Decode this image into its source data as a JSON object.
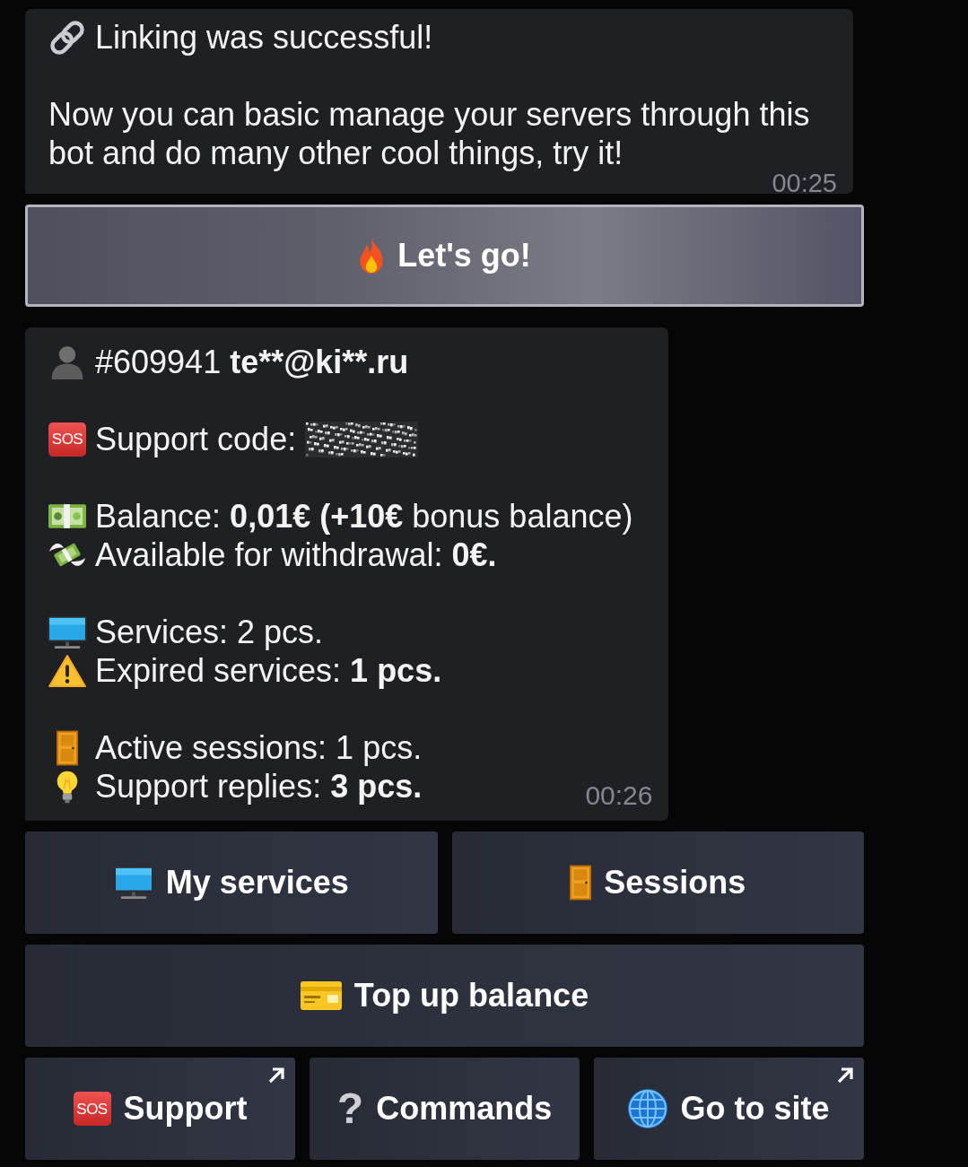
{
  "messages": [
    {
      "paragraphs": [
        {
          "lines": [
            {
              "icon": {
                "kind": "link"
              },
              "parts": [
                {
                  "kind": "text",
                  "text": "Linking was successful!",
                  "bold": false
                }
              ]
            }
          ]
        },
        {
          "lines": [
            {
              "parts": [
                {
                  "kind": "text",
                  "text": "Now you can basic manage your servers through this bot and do many other cool things, try it!",
                  "bold": false
                }
              ]
            }
          ]
        }
      ],
      "time": "00:25",
      "keyboard": [
        {
          "buttons": [
            {
              "label": "Let's go!",
              "icon": {
                "kind": "fire"
              },
              "pressed": true,
              "external": false
            }
          ]
        }
      ]
    },
    {
      "paragraphs": [
        {
          "lines": [
            {
              "icon": {
                "kind": "person"
              },
              "parts": [
                {
                  "kind": "text",
                  "text": "#609941 ",
                  "bold": false
                },
                {
                  "kind": "text",
                  "text": "te**@ki**.ru",
                  "bold": true
                }
              ]
            }
          ]
        },
        {
          "lines": [
            {
              "icon": {
                "kind": "sos",
                "text": "SOS"
              },
              "parts": [
                {
                  "kind": "text",
                  "text": "Support code:",
                  "bold": false
                },
                {
                  "kind": "redacted"
                }
              ]
            }
          ]
        },
        {
          "lines": [
            {
              "icon": {
                "kind": "banknote"
              },
              "parts": [
                {
                  "kind": "text",
                  "text": "Balance: ",
                  "bold": false
                },
                {
                  "kind": "text",
                  "text": "0,01€ (+10€",
                  "bold": true
                },
                {
                  "kind": "text",
                  "text": " bonus balance)",
                  "bold": false
                }
              ]
            },
            {
              "icon": {
                "kind": "money_wings"
              },
              "parts": [
                {
                  "kind": "text",
                  "text": "Available for withdrawal: ",
                  "bold": false
                },
                {
                  "kind": "text",
                  "text": "0€.",
                  "bold": true
                }
              ]
            }
          ]
        },
        {
          "lines": [
            {
              "icon": {
                "kind": "monitor"
              },
              "parts": [
                {
                  "kind": "text",
                  "text": "Services: 2 pcs.",
                  "bold": false
                }
              ]
            },
            {
              "icon": {
                "kind": "warning"
              },
              "parts": [
                {
                  "kind": "text",
                  "text": "Expired services: ",
                  "bold": false
                },
                {
                  "kind": "text",
                  "text": "1 pcs.",
                  "bold": true
                }
              ]
            }
          ]
        },
        {
          "lines": [
            {
              "icon": {
                "kind": "door"
              },
              "parts": [
                {
                  "kind": "text",
                  "text": "Active sessions: 1 pcs.",
                  "bold": false
                }
              ]
            },
            {
              "icon": {
                "kind": "bulb"
              },
              "parts": [
                {
                  "kind": "text",
                  "text": "Support replies: ",
                  "bold": false
                },
                {
                  "kind": "text",
                  "text": "3 pcs.",
                  "bold": true
                }
              ]
            }
          ]
        }
      ],
      "time": "00:26",
      "keyboard": [
        {
          "buttons": [
            {
              "label": "My services",
              "icon": {
                "kind": "monitor"
              },
              "pressed": false,
              "external": false
            },
            {
              "label": "Sessions",
              "icon": {
                "kind": "door"
              },
              "pressed": false,
              "external": false
            }
          ]
        },
        {
          "buttons": [
            {
              "label": "Top up balance",
              "icon": {
                "kind": "card"
              },
              "pressed": false,
              "external": false
            }
          ]
        },
        {
          "buttons": [
            {
              "label": "Support",
              "icon": {
                "kind": "sos",
                "text": "SOS"
              },
              "pressed": false,
              "external": true
            },
            {
              "label": "Commands",
              "icon": {
                "kind": "question",
                "text": "?"
              },
              "pressed": false,
              "external": false
            },
            {
              "label": "Go to site",
              "icon": {
                "kind": "globe"
              },
              "pressed": false,
              "external": true
            }
          ]
        }
      ]
    }
  ]
}
